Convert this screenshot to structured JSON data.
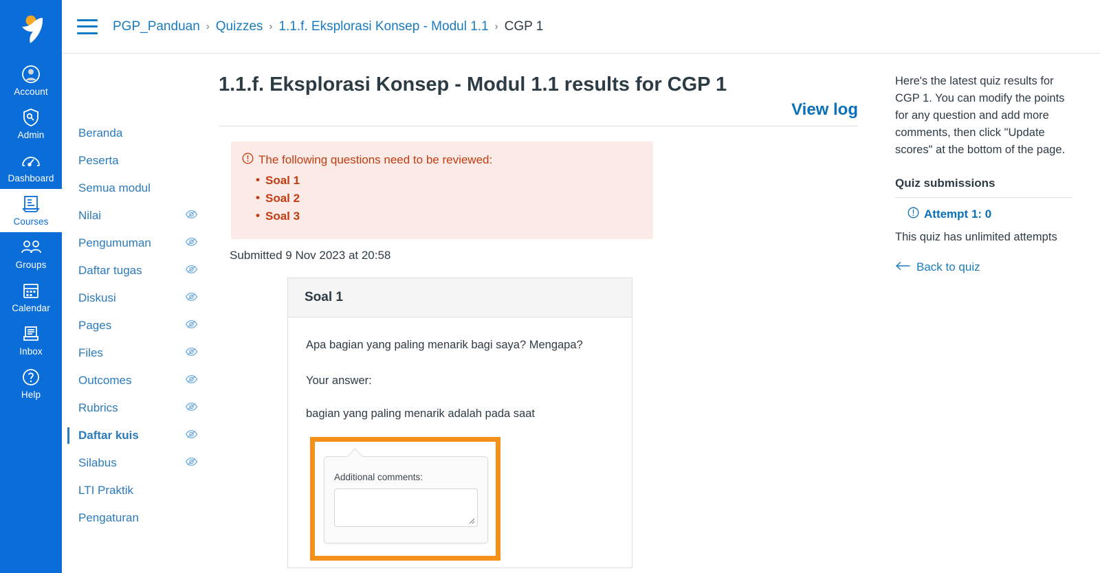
{
  "global_nav": {
    "logo_name": "canvas-logo",
    "items": [
      {
        "label": "Account",
        "icon": "user-circle-icon",
        "active": false
      },
      {
        "label": "Admin",
        "icon": "shield-wrench-icon",
        "active": false
      },
      {
        "label": "Dashboard",
        "icon": "gauge-icon",
        "active": false
      },
      {
        "label": "Courses",
        "icon": "book-icon",
        "active": true
      },
      {
        "label": "Groups",
        "icon": "people-icon",
        "active": false
      },
      {
        "label": "Calendar",
        "icon": "calendar-icon",
        "active": false
      },
      {
        "label": "Inbox",
        "icon": "inbox-icon",
        "active": false
      },
      {
        "label": "Help",
        "icon": "question-circle-icon",
        "active": false
      }
    ]
  },
  "course_nav": {
    "items": [
      {
        "label": "Beranda",
        "hidden_icon": false,
        "active": false
      },
      {
        "label": "Peserta",
        "hidden_icon": false,
        "active": false
      },
      {
        "label": "Semua modul",
        "hidden_icon": false,
        "active": false
      },
      {
        "label": "Nilai",
        "hidden_icon": true,
        "active": false
      },
      {
        "label": "Pengumuman",
        "hidden_icon": true,
        "active": false
      },
      {
        "label": "Daftar tugas",
        "hidden_icon": true,
        "active": false
      },
      {
        "label": "Diskusi",
        "hidden_icon": true,
        "active": false
      },
      {
        "label": "Pages",
        "hidden_icon": true,
        "active": false
      },
      {
        "label": "Files",
        "hidden_icon": true,
        "active": false
      },
      {
        "label": "Outcomes",
        "hidden_icon": true,
        "active": false
      },
      {
        "label": "Rubrics",
        "hidden_icon": true,
        "active": false
      },
      {
        "label": "Daftar kuis",
        "hidden_icon": true,
        "active": true
      },
      {
        "label": "Silabus",
        "hidden_icon": true,
        "active": false
      },
      {
        "label": "LTI Praktik",
        "hidden_icon": false,
        "active": false
      },
      {
        "label": "Pengaturan",
        "hidden_icon": false,
        "active": false
      }
    ]
  },
  "breadcrumb": {
    "menu_icon": "hamburger-icon",
    "items": [
      {
        "label": "PGP_Panduan",
        "last": false
      },
      {
        "label": "Quizzes",
        "last": false
      },
      {
        "label": "1.1.f. Eksplorasi Konsep - Modul 1.1",
        "last": false
      },
      {
        "label": "CGP 1",
        "last": true
      }
    ],
    "separator": "›"
  },
  "main": {
    "title": "1.1.f. Eksplorasi Konsep - Modul 1.1 results for CGP 1",
    "view_log_label": "View log",
    "alert": {
      "icon": "warning-circle-icon",
      "heading": "The following questions need to be reviewed:",
      "items": [
        "Soal 1",
        "Soal 2",
        "Soal 3"
      ]
    },
    "submitted_text": "Submitted 9 Nov 2023 at 20:58",
    "question": {
      "header": "Soal 1",
      "prompt": "Apa bagian yang paling menarik bagi saya? Mengapa?",
      "answer_label": "Your answer:",
      "answer_text": "bagian yang paling menarik adalah pada saat",
      "comment_label": "Additional comments:",
      "comment_value": "",
      "comment_placeholder": ""
    }
  },
  "right_sidebar": {
    "intro": "Here's the latest quiz results for CGP 1. You can modify the points for any question and add more comments, then click \"Update scores\" at the bottom of the page.",
    "submissions_heading": "Quiz submissions",
    "attempt_label": "Attempt 1: 0",
    "attempt_icon": "warning-circle-icon",
    "attempts_note": "This quiz has unlimited attempts",
    "back_link": "Back to quiz",
    "back_icon": "arrow-left-icon"
  },
  "colors": {
    "brand_blue": "#0b6ed8",
    "link_blue": "#1a7bbd",
    "highlight_orange": "#f5901b",
    "alert_bg": "#fbeae5",
    "alert_text": "#c23c12",
    "logo_accent": "#f5a623"
  }
}
